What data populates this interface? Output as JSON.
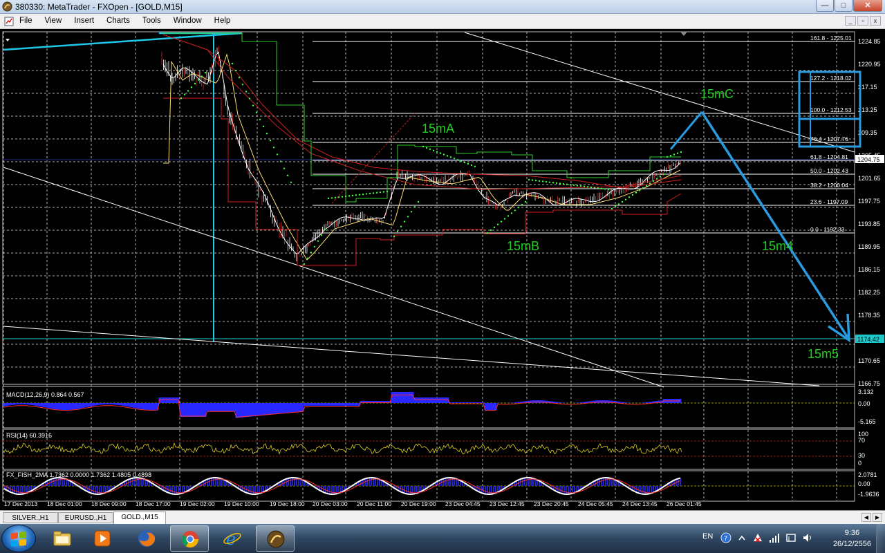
{
  "window": {
    "title": "380330: MetaTrader - FXOpen - [GOLD,M15]",
    "buttons": {
      "minimize": "—",
      "maximize": "□",
      "close": "✕"
    }
  },
  "menu": {
    "items": [
      "File",
      "View",
      "Insert",
      "Charts",
      "Tools",
      "Window",
      "Help"
    ],
    "mdi_buttons": {
      "minimize": "_",
      "restore": "▫",
      "close": "x"
    }
  },
  "chart": {
    "symbol": "GOLD,M15",
    "colors": {
      "background": "#000000",
      "grid": "#cfcfcf",
      "axis_text": "#ffffff",
      "price_line": "#2a2a8f",
      "bid_label": "#1ec8c8",
      "annotation": "#20d020",
      "drawing": "#2a9be0"
    },
    "price_axis": [
      "1224.85",
      "1220.95",
      "217.15",
      "213.25",
      "209.35",
      "1205.45",
      "1201.65",
      "1197.75",
      "1193.85",
      "1189.95",
      "1186.15",
      "1182.25",
      "1178.35",
      "1174.45",
      "1170.65",
      "1166.75"
    ],
    "current_price": "1204.75",
    "bid_line_price": "1174.42",
    "time_axis": [
      "17 Dec 2013",
      "18 Dec 01:00",
      "18 Dec 09:00",
      "18 Dec 17:00",
      "19 Dec 02:00",
      "19 Dec 10:00",
      "19 Dec 18:00",
      "20 Dec 03:00",
      "20 Dec 11:00",
      "20 Dec 19:00",
      "23 Dec 04:45",
      "23 Dec 12:45",
      "23 Dec 20:45",
      "24 Dec 05:45",
      "24 Dec 13:45",
      "26 Dec 01:45"
    ],
    "fibonacci_levels": [
      "161.8 - 1225.01",
      "127.2 - 1218.02",
      "100.0 - 1212.53",
      "76.4 - 1207.76",
      "61.8 - 1204.81",
      "50.0 - 1202.43",
      "38.2 - 1200.04",
      "23.6 - 1197.09",
      "0.0 - 1192.33"
    ],
    "annotations": [
      "15mA",
      "15mB",
      "15mC",
      "15m4",
      "15m5"
    ],
    "indicators": {
      "macd": {
        "label": "MACD(12,26,9) 0.864 0.567",
        "axis": [
          "3.132",
          "0.00",
          "-5.165"
        ]
      },
      "rsi": {
        "label": "RSI(14) 60.3916",
        "axis": [
          "100",
          "70",
          "30",
          "0"
        ]
      },
      "fish": {
        "label": "FX_FISH_2MA 1.7362 0.0000 1.7362 1.4805 0.4898",
        "axis": [
          "2.0781",
          "0.00",
          "-1.9636"
        ]
      }
    }
  },
  "tabs": [
    {
      "label": "SILVER.,H1",
      "active": false
    },
    {
      "label": "EURUSD.,H1",
      "active": false
    },
    {
      "label": "GOLD.,M15",
      "active": true
    }
  ],
  "taskbar": {
    "apps": [
      "explorer-icon",
      "media-player-icon",
      "firefox-icon",
      "chrome-icon",
      "internet-explorer-icon",
      "metatrader-icon"
    ],
    "language": "EN",
    "clock": {
      "time": "9:36",
      "date": "26/12/2556"
    }
  }
}
